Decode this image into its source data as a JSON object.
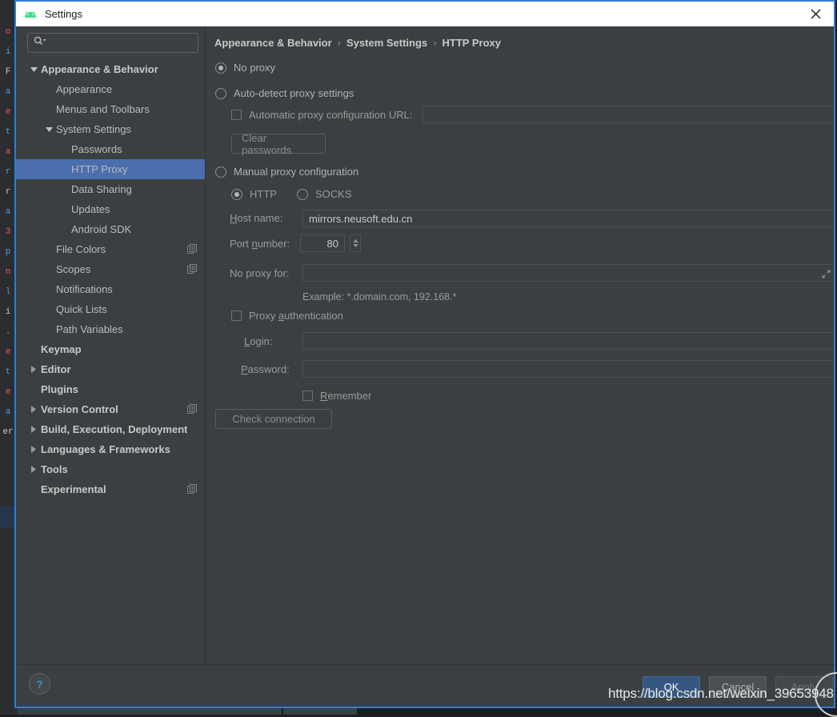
{
  "window": {
    "title": "Settings",
    "app_icon": "android-icon",
    "close_icon": "close-icon"
  },
  "search": {
    "value": "",
    "placeholder": "",
    "icon": "search-icon"
  },
  "sidebar": {
    "items": [
      {
        "label": "Appearance & Behavior",
        "indent": 0,
        "arrow": "down",
        "bold": true,
        "selected": false,
        "badge": false
      },
      {
        "label": "Appearance",
        "indent": 1,
        "arrow": "none",
        "bold": false,
        "selected": false,
        "badge": false
      },
      {
        "label": "Menus and Toolbars",
        "indent": 1,
        "arrow": "none",
        "bold": false,
        "selected": false,
        "badge": false
      },
      {
        "label": "System Settings",
        "indent": 1,
        "arrow": "down",
        "bold": false,
        "selected": false,
        "badge": false
      },
      {
        "label": "Passwords",
        "indent": 2,
        "arrow": "none",
        "bold": false,
        "selected": false,
        "badge": false
      },
      {
        "label": "HTTP Proxy",
        "indent": 2,
        "arrow": "none",
        "bold": false,
        "selected": true,
        "badge": false
      },
      {
        "label": "Data Sharing",
        "indent": 2,
        "arrow": "none",
        "bold": false,
        "selected": false,
        "badge": false
      },
      {
        "label": "Updates",
        "indent": 2,
        "arrow": "none",
        "bold": false,
        "selected": false,
        "badge": false
      },
      {
        "label": "Android SDK",
        "indent": 2,
        "arrow": "none",
        "bold": false,
        "selected": false,
        "badge": false
      },
      {
        "label": "File Colors",
        "indent": 1,
        "arrow": "none",
        "bold": false,
        "selected": false,
        "badge": true
      },
      {
        "label": "Scopes",
        "indent": 1,
        "arrow": "none",
        "bold": false,
        "selected": false,
        "badge": true
      },
      {
        "label": "Notifications",
        "indent": 1,
        "arrow": "none",
        "bold": false,
        "selected": false,
        "badge": false
      },
      {
        "label": "Quick Lists",
        "indent": 1,
        "arrow": "none",
        "bold": false,
        "selected": false,
        "badge": false
      },
      {
        "label": "Path Variables",
        "indent": 1,
        "arrow": "none",
        "bold": false,
        "selected": false,
        "badge": false
      },
      {
        "label": "Keymap",
        "indent": 0,
        "arrow": "none",
        "bold": true,
        "selected": false,
        "badge": false
      },
      {
        "label": "Editor",
        "indent": 0,
        "arrow": "right",
        "bold": true,
        "selected": false,
        "badge": false
      },
      {
        "label": "Plugins",
        "indent": 0,
        "arrow": "none",
        "bold": true,
        "selected": false,
        "badge": false
      },
      {
        "label": "Version Control",
        "indent": 0,
        "arrow": "right",
        "bold": true,
        "selected": false,
        "badge": true
      },
      {
        "label": "Build, Execution, Deployment",
        "indent": 0,
        "arrow": "right",
        "bold": true,
        "selected": false,
        "badge": false
      },
      {
        "label": "Languages & Frameworks",
        "indent": 0,
        "arrow": "right",
        "bold": true,
        "selected": false,
        "badge": false
      },
      {
        "label": "Tools",
        "indent": 0,
        "arrow": "right",
        "bold": true,
        "selected": false,
        "badge": false
      },
      {
        "label": "Experimental",
        "indent": 0,
        "arrow": "none",
        "bold": true,
        "selected": false,
        "badge": true
      }
    ]
  },
  "breadcrumb": {
    "part1": "Appearance & Behavior",
    "part2": "System Settings",
    "part3": "HTTP Proxy",
    "separator": "›"
  },
  "form": {
    "no_proxy_label": "No proxy",
    "no_proxy_selected": true,
    "auto_detect_label": "Auto-detect proxy settings",
    "auto_detect_selected": false,
    "auto_url_checkbox_label": "Automatic proxy configuration URL:",
    "auto_url_checked": false,
    "auto_url_value": "",
    "clear_passwords_label": "Clear passwords",
    "manual_label": "Manual proxy configuration",
    "manual_selected": false,
    "http_label": "HTTP",
    "http_selected": true,
    "socks_label": "SOCKS",
    "socks_selected": false,
    "host_label": "Host name:",
    "host_value": "mirrors.neusoft.edu.cn",
    "port_label": "Port number:",
    "port_value": "80",
    "no_proxy_for_label": "No proxy for:",
    "no_proxy_for_value": "",
    "example_text": "Example: *.domain.com, 192.168.*",
    "proxy_auth_label": "Proxy authentication",
    "proxy_auth_checked": false,
    "login_label": "Login:",
    "login_value": "",
    "password_label": "Password:",
    "password_value": "",
    "remember_label": "Remember",
    "remember_checked": false,
    "check_connection_label": "Check connection"
  },
  "footer": {
    "help_label": "?",
    "ok_label": "OK",
    "cancel_label": "Cancel",
    "apply_label": "Apply"
  },
  "watermark": {
    "text": "https://blog.csdn.net/weixin_39653948"
  },
  "backdrop": {
    "gutter_chars": [
      "o",
      "i",
      "F",
      "a",
      "e",
      "t",
      "a",
      "r",
      "r",
      "a",
      "3",
      "p",
      "n",
      "l",
      "i",
      ".",
      "e",
      "t",
      "e",
      "a",
      "er"
    ]
  },
  "colors": {
    "accent_blue": "#4b6eaf",
    "dialog_bg": "#3c3f41",
    "border_blue": "#2d7fd3",
    "ok_button": "#365880",
    "help_blue": "#3592c4"
  }
}
